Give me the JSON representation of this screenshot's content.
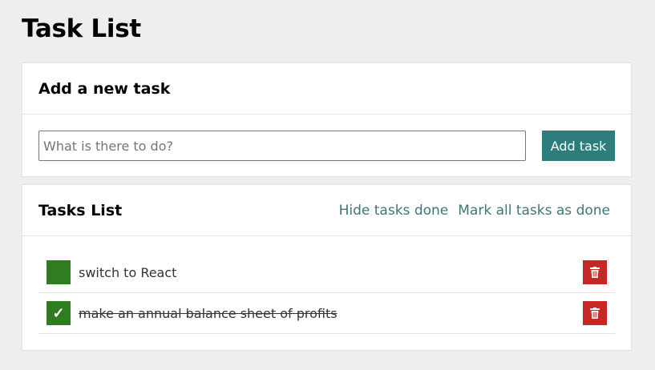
{
  "page_title": "Task List",
  "add_panel": {
    "title": "Add a new task",
    "input_placeholder": "What is there to do?",
    "input_value": "",
    "add_button_label": "Add task"
  },
  "list_panel": {
    "title": "Tasks List",
    "hide_done_label": "Hide tasks done",
    "mark_all_label": "Mark all tasks as done",
    "tasks": [
      {
        "text": "switch to React",
        "done": false,
        "check_mark": ""
      },
      {
        "text": "make an annual balance sheet of profits",
        "done": true,
        "check_mark": "✓"
      }
    ]
  },
  "icons": {
    "check": "check-icon",
    "delete": "trash-icon"
  },
  "colors": {
    "background": "#eeeeee",
    "accent": "#2e7d7d",
    "link": "#3f7676",
    "done_green": "#2f7d1f",
    "delete_red": "#c62828"
  }
}
